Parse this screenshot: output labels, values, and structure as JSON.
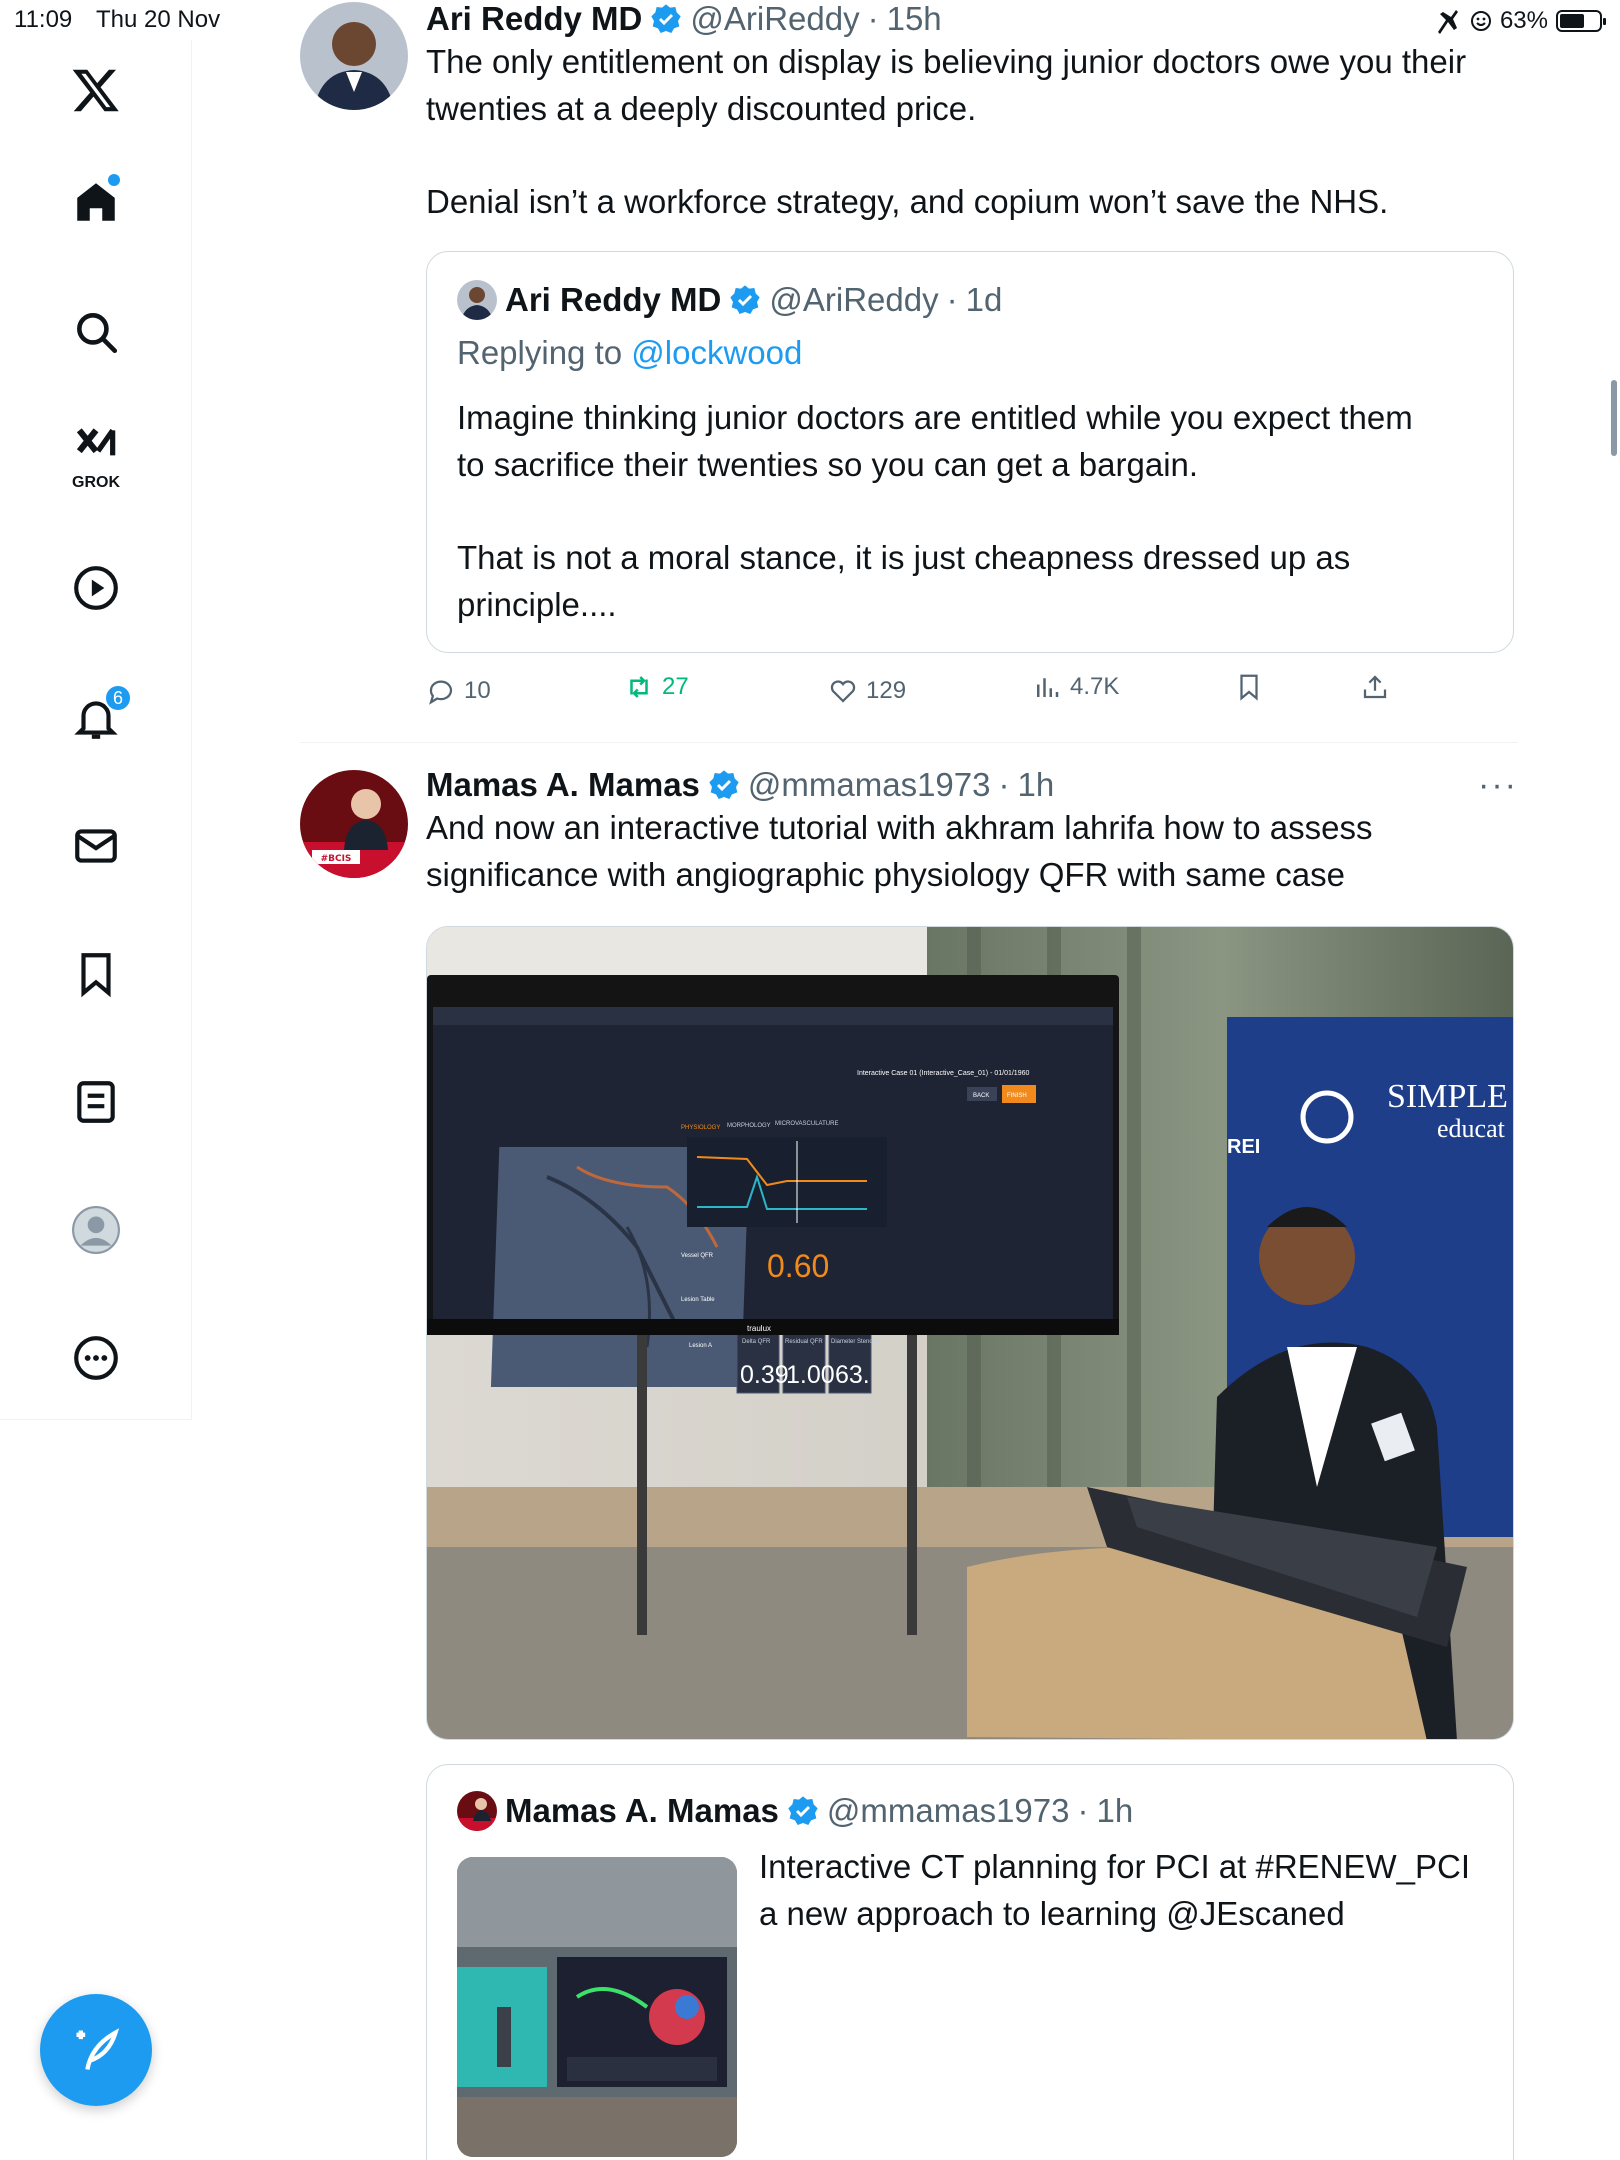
{
  "status": {
    "time": "11:09",
    "date": "Thu 20 Nov",
    "battery": "63%",
    "battery_level": 0.63
  },
  "sidebar": {
    "home_dot": true,
    "grok_label": "GROK",
    "notifications_count": "6",
    "items": [
      "x-logo",
      "home",
      "search",
      "grok",
      "video",
      "notifications",
      "messages",
      "bookmarks",
      "lists",
      "profile",
      "more"
    ]
  },
  "tweet1": {
    "name": "Ari Reddy MD",
    "handle": "@AriReddy",
    "sep": "·",
    "age": "15h",
    "text_line1": "The only entitlement on display is believing junior doctors owe you their",
    "text_line2": "twenties at a deeply discounted price.",
    "text_line3": "Denial isn’t a workforce strategy, and copium won’t save the NHS.",
    "quote": {
      "name": "Ari Reddy MD",
      "handle": "@AriReddy",
      "sep": "·",
      "age": "1d",
      "replying_prefix": "Replying to",
      "replying_to": "@lockwood",
      "line1": "Imagine thinking junior doctors are entitled while you expect them",
      "line2": "to sacrifice their twenties so you can get a bargain.",
      "line3": "That is not a moral stance, it is just cheapness dressed up as",
      "line4": "principle...."
    },
    "actions": {
      "replies": "10",
      "reposts": "27",
      "likes": "129",
      "views": "4.7K"
    }
  },
  "tweet2": {
    "name": "Mamas A. Mamas",
    "handle": "@mmamas1973",
    "sep": "·",
    "age": "1h",
    "more": "···",
    "text_line1": "And now an interactive tutorial with akhram lahrifa how to assess",
    "text_line2": "significance with angiographic physiology QFR with same case",
    "photo": {
      "screen_value": "0.60",
      "cells": [
        "0.39",
        "1.00",
        "63."
      ],
      "cell_headers": [
        "Delta QFR",
        "Residual QFR",
        "Diameter Stenosis"
      ],
      "banner_text_1": "SIMPLE",
      "banner_text_2": "educat",
      "banner_rei": "REI",
      "monitor_brand": "traulux",
      "tab_physiology": "PHYSIOLOGY",
      "tab_morphology": "MORPHOLOGY",
      "tab_micro": "MICROVASCULATURE",
      "btn_back": "BACK",
      "btn_finish": "FINISH",
      "case_title": "Interactive Case 01 (Interactive_Case_01) - 01/01/1960",
      "vessel_qfr": "Vessel QFR",
      "lesion_table": "Lesion Table",
      "lesion_a": "Lesion A"
    },
    "quote": {
      "name": "Mamas A. Mamas",
      "handle": "@mmamas1973",
      "sep": "·",
      "age": "1h",
      "line1": "Interactive CT planning for PCI at #RENEW_PCI",
      "line2": "a new approach to learning @JEscaned"
    }
  },
  "colors": {
    "accent": "#1d9bf0",
    "repost": "#00ba7c",
    "text": "#0f1419",
    "muted": "#536471"
  }
}
